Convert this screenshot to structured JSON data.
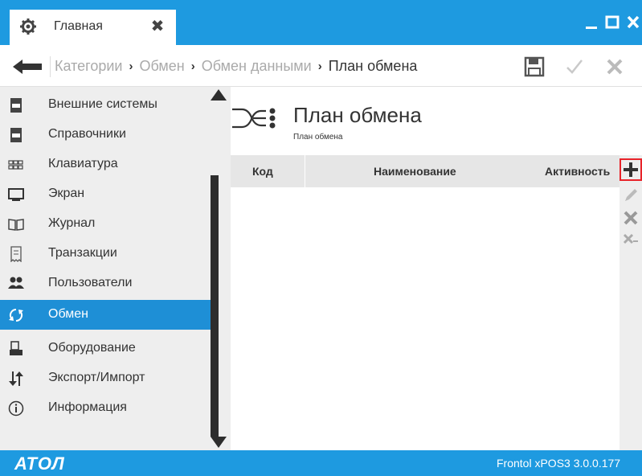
{
  "window": {
    "tab_label": "Главная",
    "tab_close_glyph": "✖"
  },
  "breadcrumb": {
    "items": [
      "Категории",
      "Обмен",
      "Обмен данными",
      "План обмена"
    ],
    "separator": "›"
  },
  "sidebar": {
    "items": [
      {
        "label": "Внешние системы",
        "icon": "document-icon"
      },
      {
        "label": "Справочники",
        "icon": "document-icon"
      },
      {
        "label": "Клавиатура",
        "icon": "keyboard-icon"
      },
      {
        "label": "Экран",
        "icon": "monitor-icon"
      },
      {
        "label": "Журнал",
        "icon": "book-icon"
      },
      {
        "label": "Транзакции",
        "icon": "receipt-icon"
      },
      {
        "label": "Пользователи",
        "icon": "users-icon"
      },
      {
        "label": "Обмен",
        "icon": "sync-icon",
        "active": true
      },
      {
        "label": "Оборудование",
        "icon": "printer-icon"
      },
      {
        "label": "Экспорт/Импорт",
        "icon": "arrows-icon"
      },
      {
        "label": "Информация",
        "icon": "info-icon"
      }
    ]
  },
  "main": {
    "title": "План обмена",
    "subtitle": "План обмена",
    "table": {
      "columns": [
        "Код",
        "Наименование",
        "Активность"
      ],
      "rows": []
    }
  },
  "footer": {
    "logo": "АТОЛ",
    "version": "Frontol xPOS3 3.0.0.177"
  },
  "colors": {
    "accent": "#1e9ae0",
    "active_item": "#1e8fd6",
    "highlight": "#e8232a"
  }
}
